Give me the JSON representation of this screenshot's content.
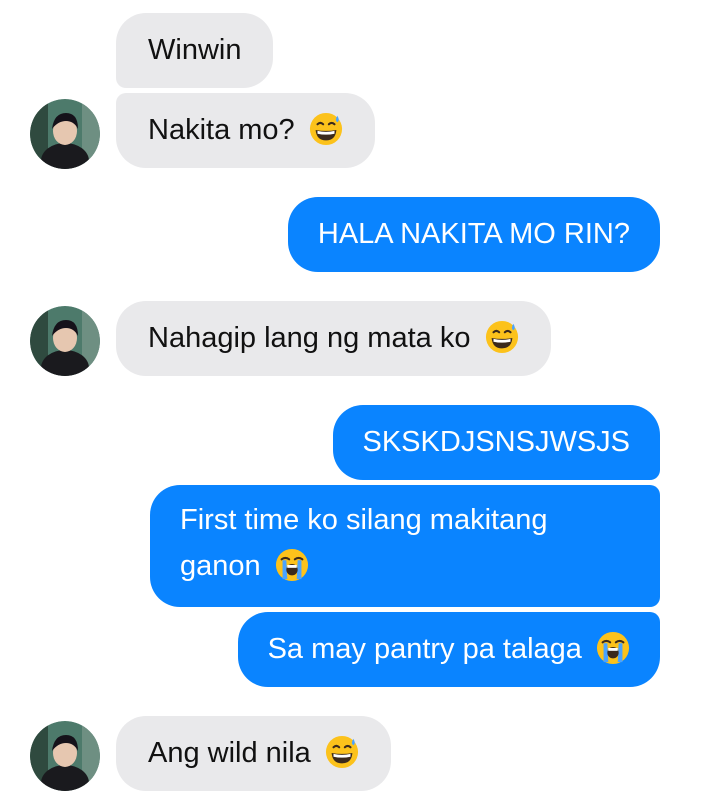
{
  "messages": [
    {
      "side": "in",
      "text": "Winwin",
      "emoji": null,
      "avatar": false
    },
    {
      "side": "in",
      "text": "Nakita mo?",
      "emoji": "sweat-smile-emoji",
      "avatar": true
    },
    {
      "side": "out",
      "text": "HALA NAKITA MO RIN?",
      "emoji": null
    },
    {
      "side": "in",
      "text": "Nahagip lang ng mata ko",
      "emoji": "sweat-smile-emoji",
      "avatar": true
    },
    {
      "side": "out",
      "text": "SKSKDJSNSJWSJS",
      "emoji": null
    },
    {
      "side": "out",
      "text": "First time ko silang makitang ganon",
      "emoji": "loudly-crying-emoji"
    },
    {
      "side": "out",
      "text": "Sa may pantry pa talaga",
      "emoji": "loudly-crying-emoji"
    },
    {
      "side": "in",
      "text": "Ang wild nila",
      "emoji": "sweat-smile-emoji",
      "avatar": true
    }
  ],
  "colors": {
    "incoming_bubble": "#e9e9eb",
    "outgoing_bubble": "#0a84ff",
    "incoming_text": "#111111",
    "outgoing_text": "#ffffff"
  }
}
